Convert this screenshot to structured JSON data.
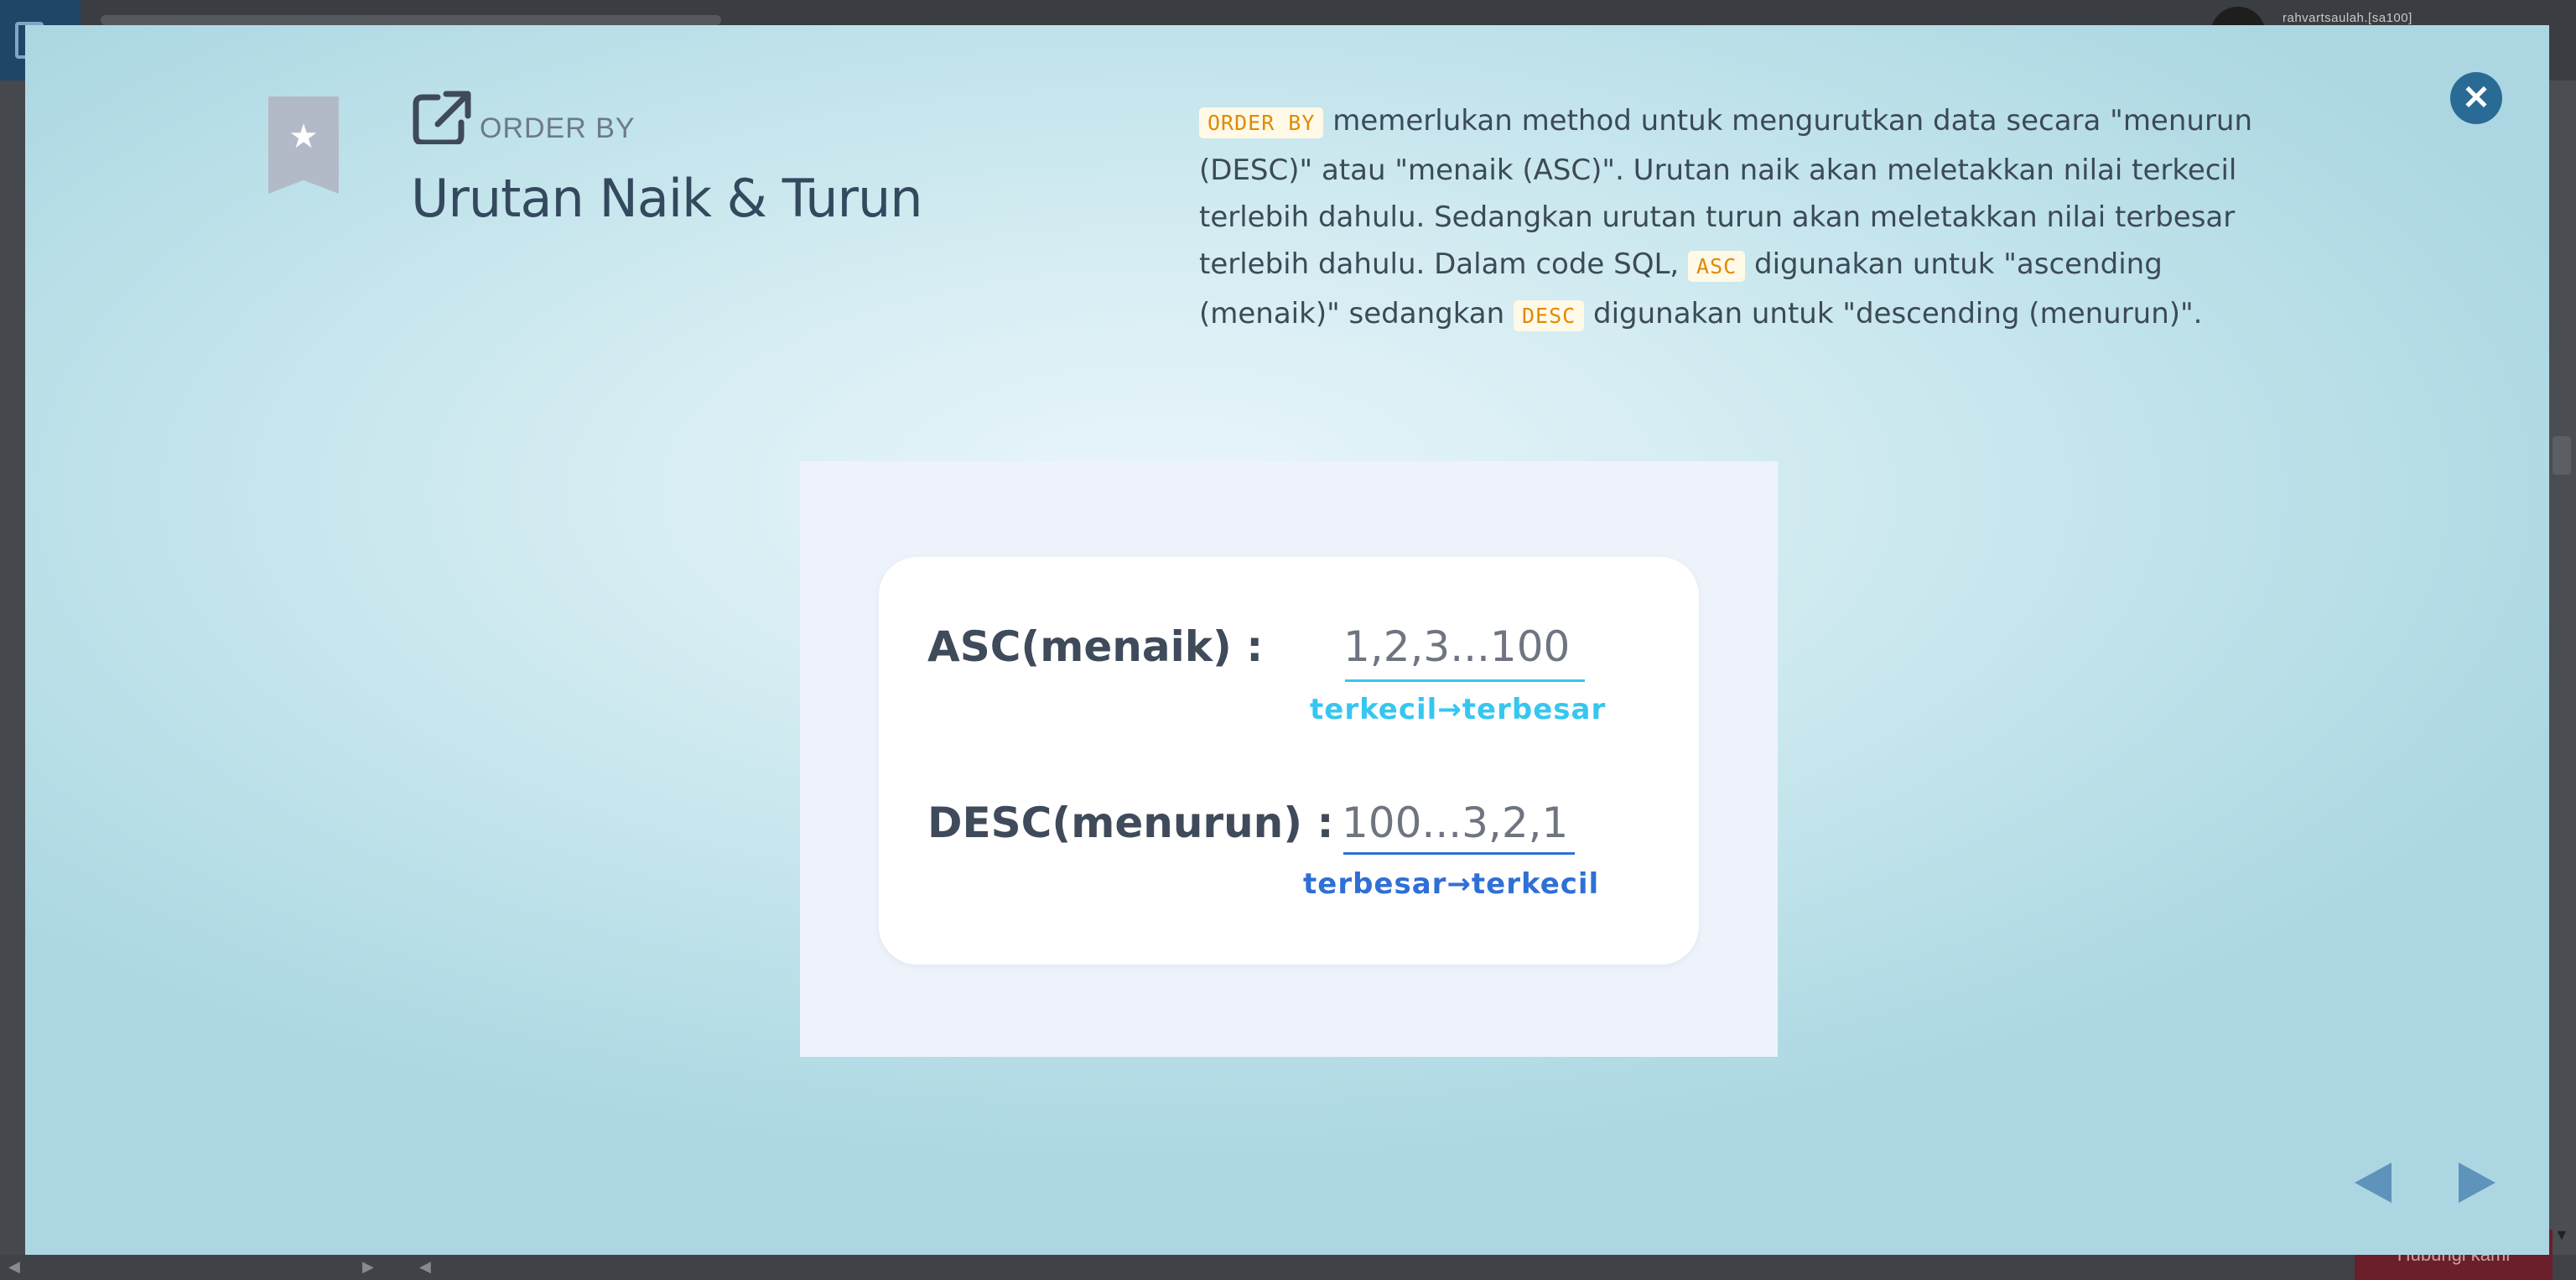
{
  "background_page": {
    "username": "rahvartsaulah.[sa100]",
    "feedback_label": "Hubungi kami"
  },
  "modal": {
    "eyebrow": "ORDER BY",
    "title": "Urutan Naik & Turun",
    "description": {
      "code_order_by": "ORDER BY",
      "text_1": " memerlukan method untuk mengurutkan data secara \"menurun (DESC)\" atau \"menaik (ASC)\". Urutan naik akan meletakkan nilai terkecil terlebih dahulu. Sedangkan urutan turun akan meletakkan nilai terbesar terlebih dahulu. Dalam code SQL, ",
      "code_asc": "ASC",
      "text_2": " digunakan untuk \"ascending (menaik)\" sedangkan ",
      "code_desc": "DESC",
      "text_3": " digunakan untuk \"descending (menurun)\"."
    },
    "illustration": {
      "asc_label": "ASC(menaik) :",
      "asc_value": "1,2,3...100",
      "asc_caption": "terkecil→terbesar",
      "desc_label": "DESC(menurun) :",
      "desc_value": "100...3,2,1",
      "desc_caption": "terbesar→terkecil"
    },
    "icons": {
      "bookmark": "star-bookmark-icon",
      "external": "external-link-icon",
      "close": "close-icon",
      "prev": "prev-arrow-icon",
      "next": "next-arrow-icon"
    },
    "colors": {
      "accent": "#2a6b96",
      "code_text": "#e08a00",
      "asc_caption": "#36c6f0",
      "desc_caption": "#2f6fd6"
    }
  }
}
